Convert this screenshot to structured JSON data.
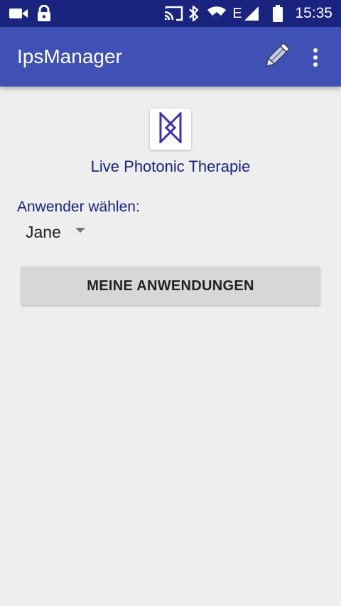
{
  "status_bar": {
    "time": "15:35",
    "network_type": "E",
    "icons": [
      "video-camera-icon",
      "lock-icon",
      "cast-icon",
      "bluetooth-icon",
      "wifi-icon",
      "signal-icon",
      "battery-icon"
    ]
  },
  "app_bar": {
    "title": "IpsManager",
    "actions": [
      "edit-icon",
      "more-vertical-icon"
    ]
  },
  "main": {
    "logo_icon": "bowtie-logo-icon",
    "subtitle": "Live Photonic Therapie",
    "user_label": "Anwender wählen:",
    "selected_user": "Jane",
    "button_label": "MEINE ANWENDUNGEN"
  },
  "colors": {
    "status_bar": "#1a237e",
    "app_bar": "#3f51b5",
    "background": "#eeeeee",
    "accent_text": "#1a237e",
    "button": "#d6d7d7"
  }
}
